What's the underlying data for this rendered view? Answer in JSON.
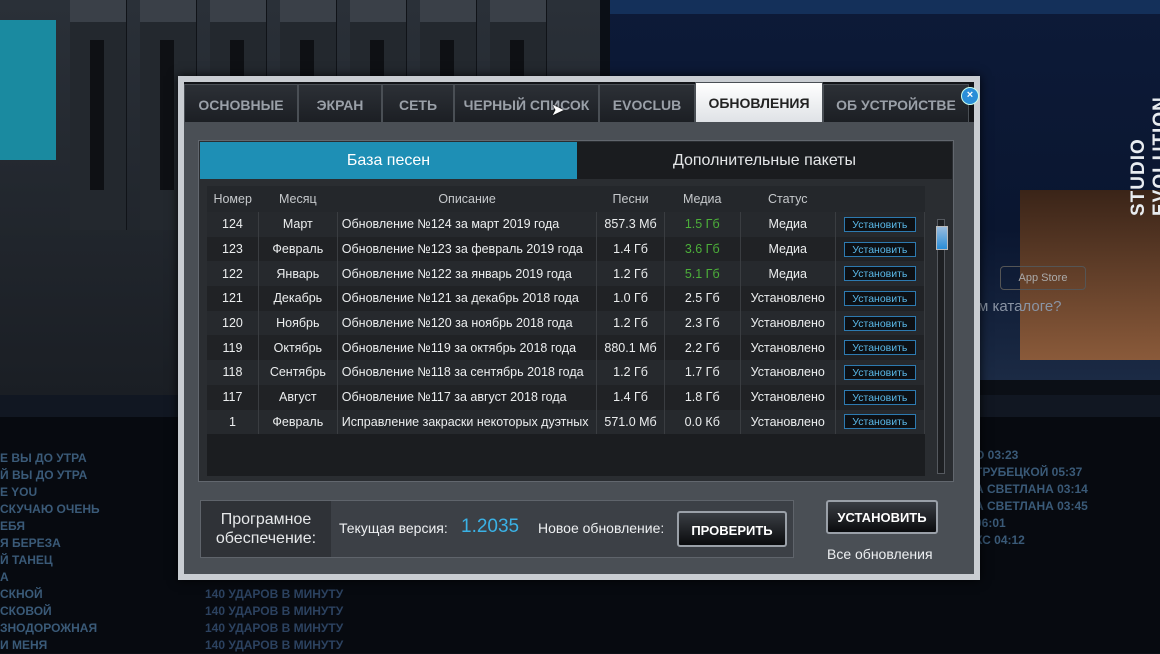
{
  "background": {
    "brand": "STUDIO EVOLUTION",
    "appstore": "App Store",
    "catalog_text": "м каталоге?",
    "left_songs": [
      "Е ВЫ ДО УТРА",
      "Й ВЫ ДО УТРА",
      "E YOU",
      "СКУЧАЮ ОЧЕНЬ",
      "ЕБЯ",
      "Я БЕРЕЗА",
      "Й ТАНЕЦ",
      "А",
      "СКНОЙ",
      "СКОВОЙ",
      "ЗНОДОРОЖНАЯ",
      "И МЕНЯ"
    ],
    "tempo_rows": [
      "140 УДАРОВ В МИНУТУ",
      "140 УДАРОВ В МИНУТУ",
      "140 УДАРОВ В МИНУТУ",
      "140 УДАРОВ В МИНУТУ"
    ],
    "right_songs": [
      "О 03:23",
      "ТРУБЕЦКОЙ 05:37",
      "А СВЕТЛАНА 03:14",
      "А СВЕТЛАНА 03:45",
      "06:01",
      "КС 04:12"
    ]
  },
  "tabs": [
    "ОСНОВНЫЕ",
    "ЭКРАН",
    "СЕТЬ",
    "ЧЕРНЫЙ СПИСОК",
    "EVOCLUB",
    "ОБНОВЛЕНИЯ",
    "ОБ УСТРОЙСТВЕ"
  ],
  "subtabs": {
    "songs": "База песен",
    "packs": "Дополнительные пакеты"
  },
  "table": {
    "headers": [
      "Номер",
      "Месяц",
      "Описание",
      "Песни",
      "Медиа",
      "Статус"
    ],
    "install_label": "Установить",
    "rows": [
      {
        "num": "124",
        "month": "Март",
        "desc": "Обновление №124 за март 2019 года",
        "songs": "857.3 Мб",
        "media": "1.5 Гб",
        "status": "Медиа",
        "media_green": true
      },
      {
        "num": "123",
        "month": "Февраль",
        "desc": "Обновление №123 за февраль 2019 года",
        "songs": "1.4 Гб",
        "media": "3.6 Гб",
        "status": "Медиа",
        "media_green": true
      },
      {
        "num": "122",
        "month": "Январь",
        "desc": "Обновление №122 за январь 2019 года",
        "songs": "1.2 Гб",
        "media": "5.1 Гб",
        "status": "Медиа",
        "media_green": true
      },
      {
        "num": "121",
        "month": "Декабрь",
        "desc": "Обновление №121 за декабрь 2018 года",
        "songs": "1.0 Гб",
        "media": "2.5 Гб",
        "status": "Установлено",
        "media_green": false
      },
      {
        "num": "120",
        "month": "Ноябрь",
        "desc": "Обновление №120 за ноябрь 2018 года",
        "songs": "1.2 Гб",
        "media": "2.3 Гб",
        "status": "Установлено",
        "media_green": false
      },
      {
        "num": "119",
        "month": "Октябрь",
        "desc": "Обновление №119 за октябрь 2018 года",
        "songs": "880.1 Мб",
        "media": "2.2 Гб",
        "status": "Установлено",
        "media_green": false
      },
      {
        "num": "118",
        "month": "Сентябрь",
        "desc": "Обновление №118 за сентябрь 2018 года",
        "songs": "1.2 Гб",
        "media": "1.7 Гб",
        "status": "Установлено",
        "media_green": false
      },
      {
        "num": "117",
        "month": "Август",
        "desc": "Обновление №117 за август 2018 года",
        "songs": "1.4 Гб",
        "media": "1.8 Гб",
        "status": "Установлено",
        "media_green": false
      },
      {
        "num": "1",
        "month": "Февраль",
        "desc": "Исправление закраски некоторых дуэтных",
        "songs": "571.0 Мб",
        "media": "0.0 Кб",
        "status": "Установлено",
        "media_green": false
      }
    ]
  },
  "footer": {
    "software_label": "Програмное обеспечение:",
    "current_label": "Текущая версия:",
    "current_version": "1.2035",
    "new_label": "Новое обновление:",
    "check_button": "ПРОВЕРИТЬ",
    "install_button": "УСТАНОВИТЬ",
    "all_updates": "Все обновления"
  }
}
